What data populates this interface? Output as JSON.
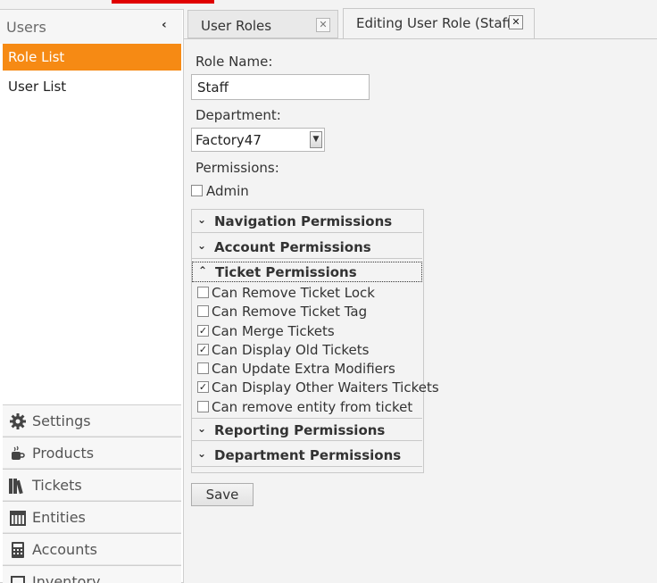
{
  "sidebar": {
    "title": "Users",
    "items": [
      {
        "label": "Role List",
        "active": true
      },
      {
        "label": "User List",
        "active": false
      }
    ],
    "nav": [
      {
        "label": "Settings",
        "icon": "gear-icon"
      },
      {
        "label": "Products",
        "icon": "coffee-cup-icon"
      },
      {
        "label": "Tickets",
        "icon": "books-icon"
      },
      {
        "label": "Entities",
        "icon": "table-icon"
      },
      {
        "label": "Accounts",
        "icon": "calculator-icon"
      },
      {
        "label": "Inventory",
        "icon": "box-icon"
      }
    ]
  },
  "tabs": [
    {
      "label": "User Roles",
      "active": false
    },
    {
      "label": "Editing User Role (Staff)",
      "active": true
    }
  ],
  "form": {
    "role_name_label": "Role Name:",
    "role_name_value": "Staff",
    "department_label": "Department:",
    "department_value": "Factory47",
    "permissions_label": "Permissions:",
    "admin_label": "Admin",
    "admin_checked": false
  },
  "sections": [
    {
      "title": "Navigation Permissions",
      "open": false
    },
    {
      "title": "Account Permissions",
      "open": false
    },
    {
      "title": "Ticket Permissions",
      "open": true
    },
    {
      "title": "Reporting Permissions",
      "open": false
    },
    {
      "title": "Department Permissions",
      "open": false
    }
  ],
  "ticket_permissions": [
    {
      "label": "Can Remove Ticket Lock",
      "checked": false
    },
    {
      "label": "Can Remove Ticket Tag",
      "checked": false
    },
    {
      "label": "Can Merge Tickets",
      "checked": true
    },
    {
      "label": "Can Display Old Tickets",
      "checked": true
    },
    {
      "label": "Can Update Extra Modifiers",
      "checked": false
    },
    {
      "label": "Can Display Other Waiters Tickets",
      "checked": true
    },
    {
      "label": "Can remove entity from ticket",
      "checked": false
    }
  ],
  "save_label": "Save",
  "colors": {
    "accent": "#f68a14",
    "top_bar": "#e00000"
  }
}
